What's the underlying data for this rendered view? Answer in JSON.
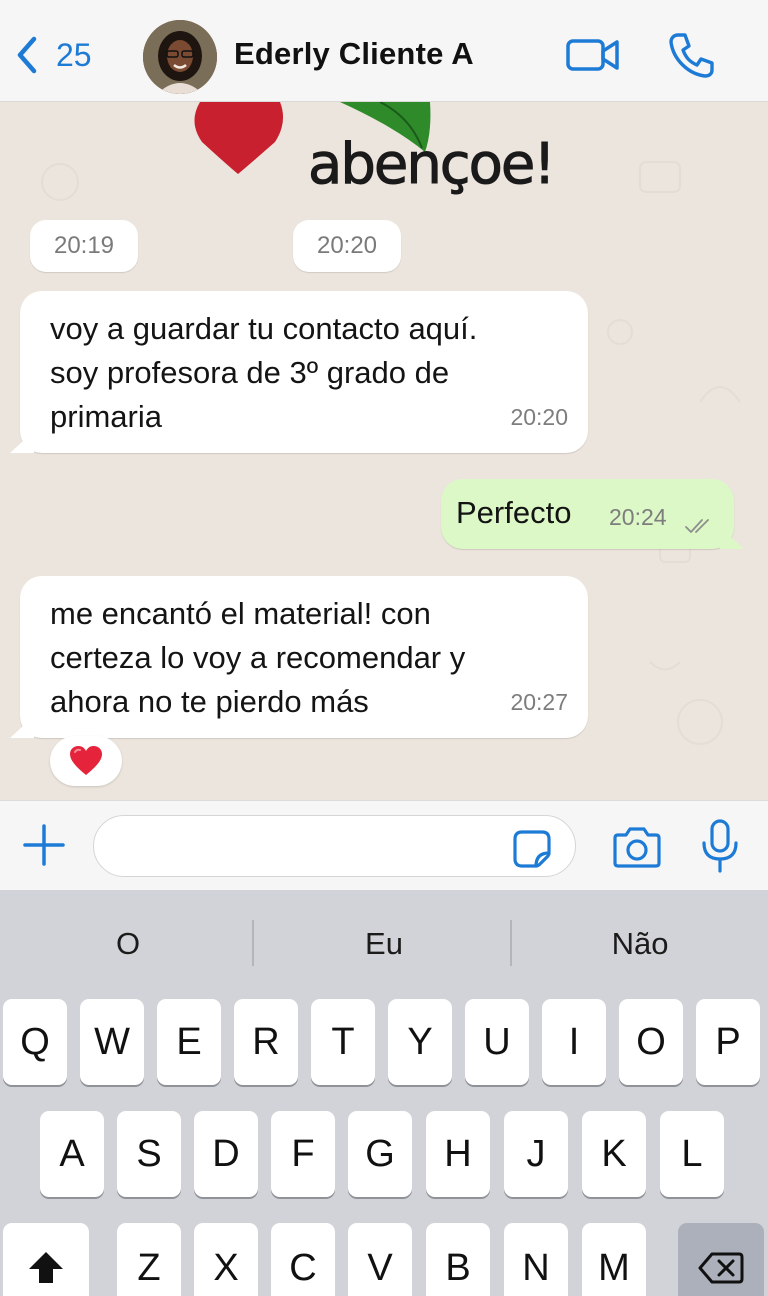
{
  "header": {
    "back_count": "25",
    "contact_name": "Ederly Cliente A",
    "accent_color": "#1d7bd6"
  },
  "chat": {
    "sticker_text": "abençoe!",
    "time_pills": [
      "20:19",
      "20:20"
    ],
    "messages": [
      {
        "direction": "incoming",
        "lines": [
          "voy a guardar tu contacto aquí.",
          "soy profesora de 3º grado de",
          "primaria"
        ],
        "time": "20:20"
      },
      {
        "direction": "outgoing",
        "lines": [
          "Perfecto"
        ],
        "time": "20:24",
        "status": "read-double-check"
      },
      {
        "direction": "incoming",
        "lines": [
          "me encantó el material! con",
          "certeza lo voy a recomendar y",
          "ahora no te pierdo más"
        ],
        "time": "20:27",
        "reaction": "❤️"
      }
    ]
  },
  "input": {
    "value": "",
    "placeholder": ""
  },
  "keyboard": {
    "suggestions": [
      "O",
      "Eu",
      "Não"
    ],
    "row1": [
      "Q",
      "W",
      "E",
      "R",
      "T",
      "Y",
      "U",
      "I",
      "O",
      "P"
    ],
    "row2": [
      "A",
      "S",
      "D",
      "F",
      "G",
      "H",
      "J",
      "K",
      "L"
    ],
    "row3": [
      "Z",
      "X",
      "C",
      "V",
      "B",
      "N",
      "M"
    ],
    "shift_icon": "shift-arrow-icon",
    "delete_icon": "backspace-icon"
  }
}
